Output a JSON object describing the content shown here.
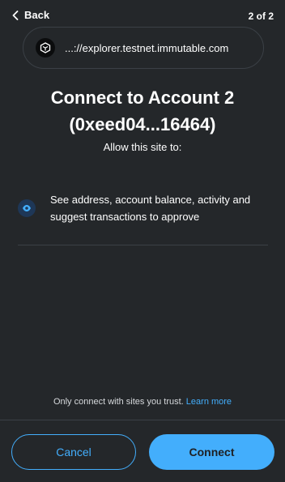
{
  "header": {
    "back_label": "Back",
    "pager": "2 of 2"
  },
  "origin": {
    "url": "...://explorer.testnet.immutable.com",
    "icon": "immutable-logo-icon"
  },
  "main": {
    "title_line1": "Connect to Account 2",
    "title_line2": "(0xeed04...16464)",
    "subtitle": "Allow this site to:",
    "permission_text": "See address, account balance, activity and suggest transactions to approve",
    "permission_icon": "eye-icon"
  },
  "footer": {
    "note": "Only connect with sites you trust.",
    "learn_more": "Learn more",
    "cancel_label": "Cancel",
    "connect_label": "Connect"
  },
  "colors": {
    "background": "#24272a",
    "accent": "#43aefc",
    "border": "#3b4046"
  }
}
